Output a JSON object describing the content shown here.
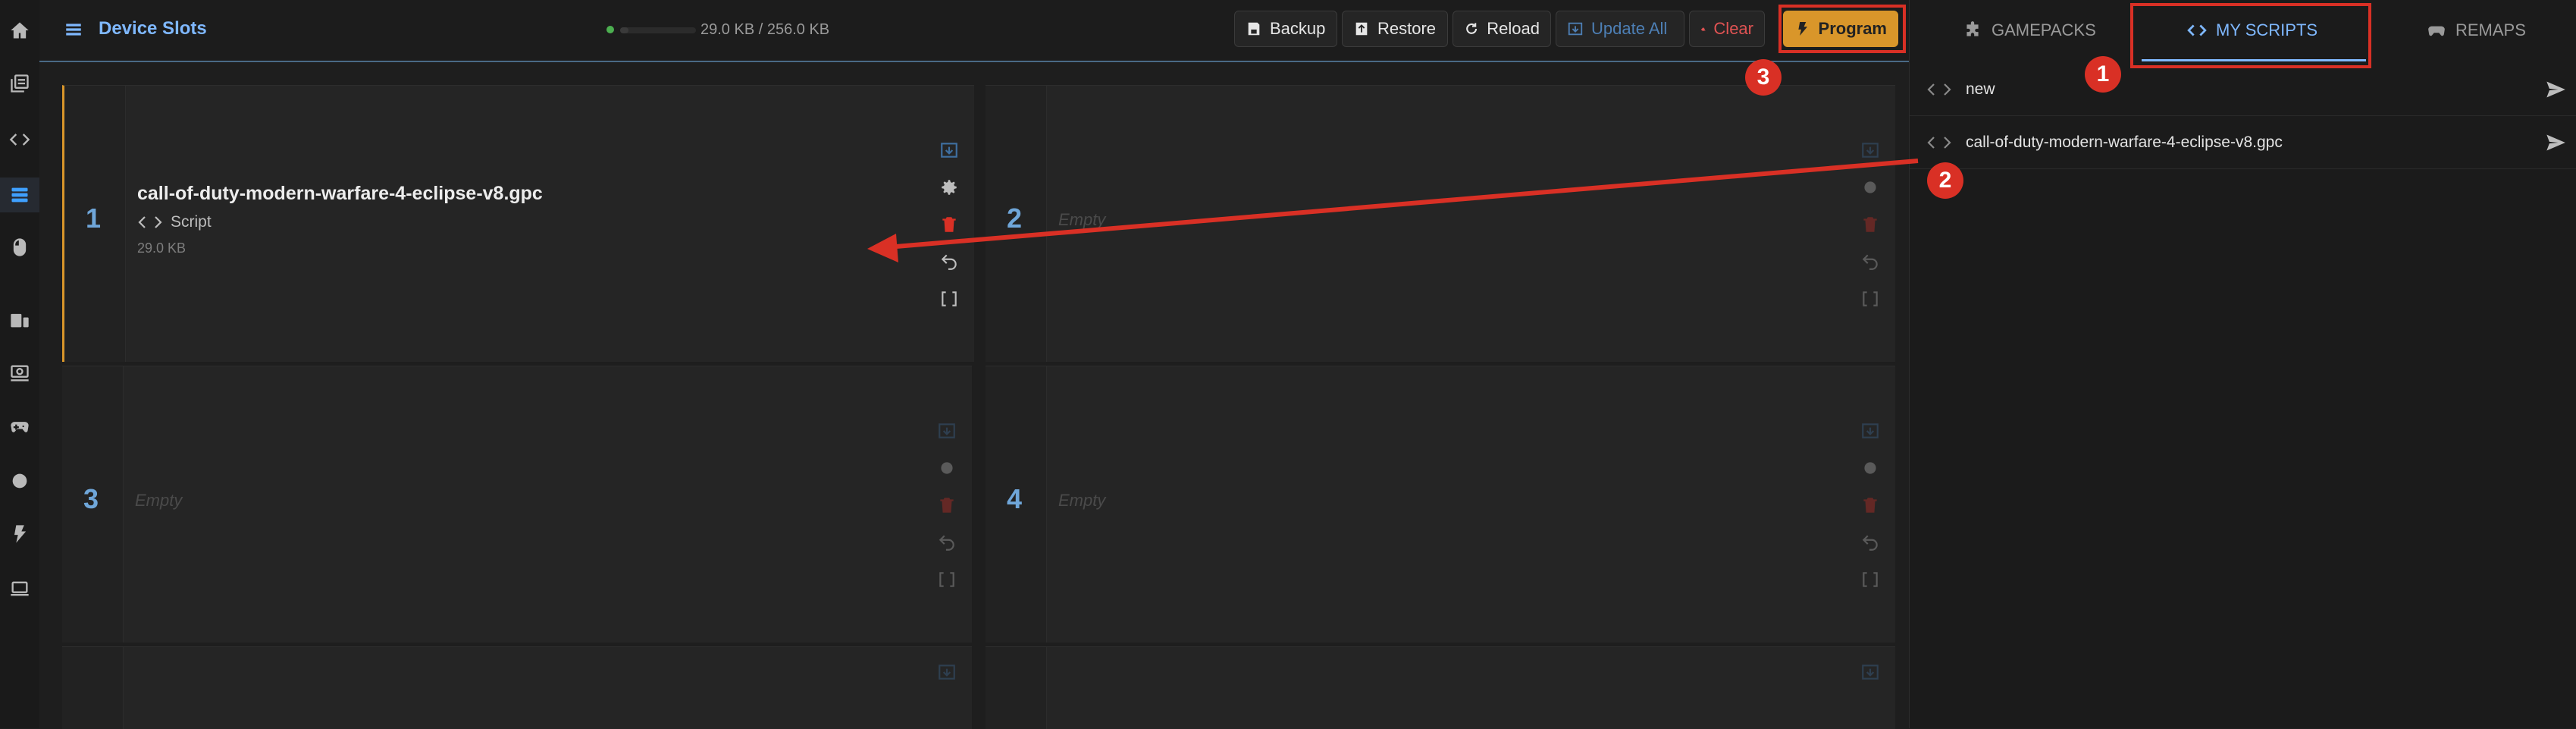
{
  "header": {
    "title": "Device Slots",
    "memory_text": "29.0 KB / 256.0 KB",
    "memory_fraction": 0.113
  },
  "toolbar": {
    "backup": "Backup",
    "restore": "Restore",
    "reload": "Reload",
    "update_all": "Update All",
    "clear": "Clear",
    "program": "Program"
  },
  "slots": [
    {
      "number": "1",
      "name": "call-of-duty-modern-warfare-4-eclipse-v8.gpc",
      "type": "Script",
      "size": "29.0 KB"
    },
    {
      "number": "2",
      "empty": "Empty"
    },
    {
      "number": "3",
      "empty": "Empty"
    },
    {
      "number": "4",
      "empty": "Empty"
    }
  ],
  "right_panel": {
    "tabs": [
      "GAMEPACKS",
      "MY SCRIPTS",
      "REMAPS"
    ],
    "active_tab": "MY SCRIPTS",
    "scripts": [
      {
        "name": "new"
      },
      {
        "name": "call-of-duty-modern-warfare-4-eclipse-v8.gpc"
      }
    ]
  },
  "annotations": {
    "badges": [
      "1",
      "2",
      "3"
    ]
  },
  "colors": {
    "accent": "#7fb8ff",
    "program": "#d9962a",
    "danger": "#e05353",
    "annotation": "#d93025"
  },
  "icons": {
    "nav": [
      "home-icon",
      "library-icon",
      "code-icon",
      "device-slots-icon",
      "mouse-icon",
      "devices-icon",
      "screen-icon",
      "gamepad-icon",
      "circle-icon",
      "bolt-icon",
      "laptop-icon"
    ]
  }
}
